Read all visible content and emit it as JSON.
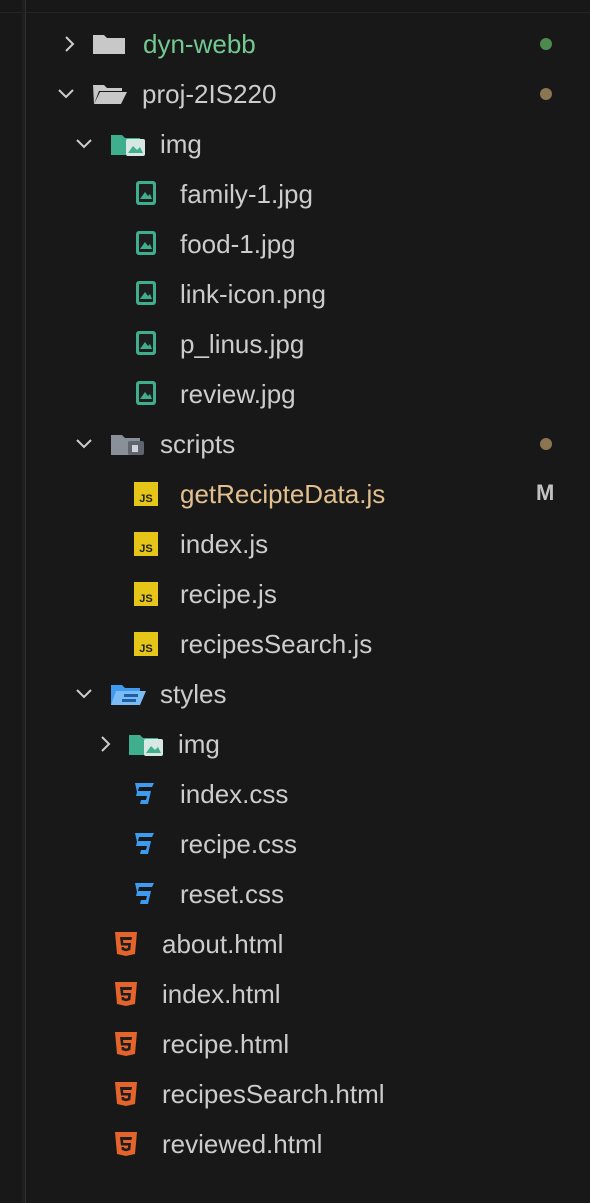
{
  "explorer": {
    "items": [
      {
        "label": "dyn-webb",
        "type": "folder",
        "expanded": false,
        "status_color": "#4d8a4e"
      },
      {
        "label": "proj-2IS220",
        "type": "folder",
        "expanded": true,
        "status_color": "#8a7652"
      },
      {
        "label": "img",
        "type": "img-folder",
        "expanded": true
      },
      {
        "label": "family-1.jpg",
        "type": "image-file"
      },
      {
        "label": "food-1.jpg",
        "type": "image-file"
      },
      {
        "label": "link-icon.png",
        "type": "image-file"
      },
      {
        "label": "p_linus.jpg",
        "type": "image-file"
      },
      {
        "label": "review.jpg",
        "type": "image-file"
      },
      {
        "label": "scripts",
        "type": "scripts-folder",
        "expanded": true,
        "status_color": "#8a7652"
      },
      {
        "label": "getRecipteData.js",
        "type": "js-file",
        "status": "M"
      },
      {
        "label": "index.js",
        "type": "js-file"
      },
      {
        "label": "recipe.js",
        "type": "js-file"
      },
      {
        "label": "recipesSearch.js",
        "type": "js-file"
      },
      {
        "label": "styles",
        "type": "styles-folder",
        "expanded": true
      },
      {
        "label": "img",
        "type": "img-folder",
        "expanded": false
      },
      {
        "label": "index.css",
        "type": "css-file"
      },
      {
        "label": "recipe.css",
        "type": "css-file"
      },
      {
        "label": "reset.css",
        "type": "css-file"
      },
      {
        "label": "about.html",
        "type": "html-file"
      },
      {
        "label": "index.html",
        "type": "html-file"
      },
      {
        "label": "recipe.html",
        "type": "html-file"
      },
      {
        "label": "recipesSearch.html",
        "type": "html-file"
      },
      {
        "label": "reviewed.html",
        "type": "html-file"
      }
    ]
  },
  "colors": {
    "background": "#181818",
    "text": "#cccccc",
    "untracked_green": "#73c991",
    "js_yellow": "#e5c517",
    "css_blue": "#3e9bf0",
    "html_orange": "#e4642b",
    "image_teal": "#3fae8d"
  }
}
